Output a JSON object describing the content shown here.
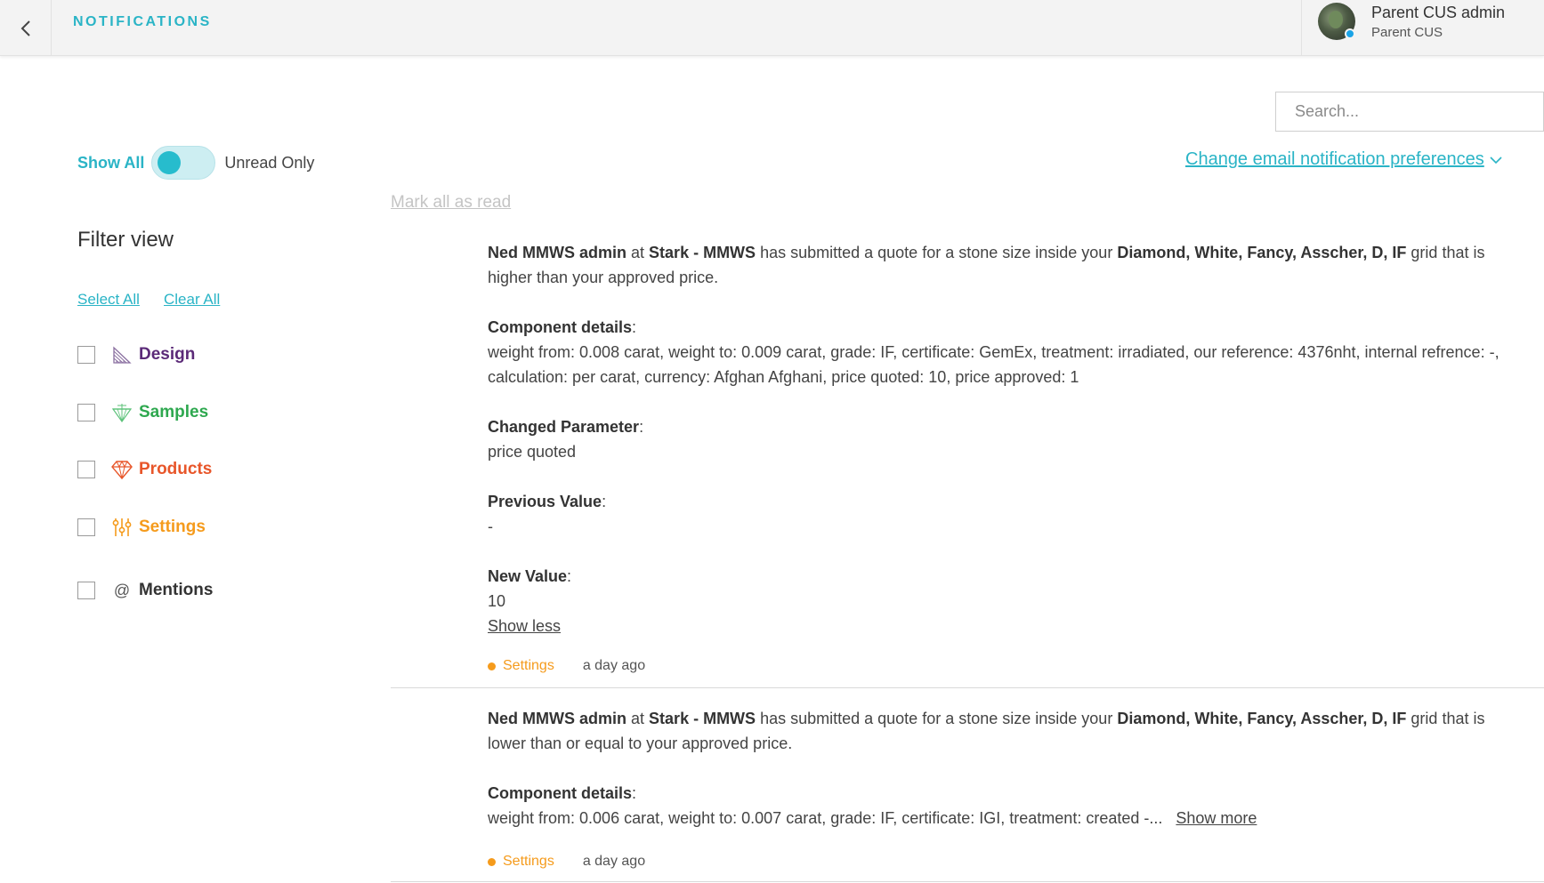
{
  "header": {
    "title": "NOTIFICATIONS",
    "user_name": "Parent CUS admin",
    "user_org": "Parent CUS"
  },
  "search": {
    "placeholder": "Search...",
    "value": ""
  },
  "toggle": {
    "left_label": "Show All",
    "right_label": "Unread Only"
  },
  "email_prefs_label": "Change email notification preferences",
  "mark_all_label": "Mark all as read",
  "filter": {
    "title": "Filter view",
    "select_all": "Select All",
    "clear_all": "Clear All",
    "items": [
      {
        "label": "Design",
        "color": "#5b2a78",
        "icon": "design-icon"
      },
      {
        "label": "Samples",
        "color": "#2ea84f",
        "icon": "samples-icon"
      },
      {
        "label": "Products",
        "color": "#e8562a",
        "icon": "products-icon"
      },
      {
        "label": "Settings",
        "color": "#f59b1c",
        "icon": "settings-icon"
      },
      {
        "label": "Mentions",
        "color": "#333333",
        "icon": "at-icon"
      }
    ]
  },
  "notifications": [
    {
      "author": "Ned MMWS admin",
      "at": "at",
      "company": "Stark - MMWS",
      "text1": "has submitted a quote for a stone size inside your",
      "grid": "Diamond, White, Fancy, Asscher, D, IF",
      "text2": "grid that is higher than your approved price.",
      "component_label": "Component details",
      "component_value": "weight from: 0.008 carat, weight to: 0.009 carat, grade: IF, certificate: GemEx, treatment: irradiated, our reference: 4376nht, internal refrence: -, calculation: per carat, currency: Afghan Afghani, price quoted: 10, price approved: 1",
      "changed_label": "Changed Parameter",
      "changed_value": "price quoted",
      "previous_label": "Previous Value",
      "previous_value": "-",
      "new_label": "New Value",
      "new_value": "10",
      "toggle_link": "Show less",
      "category": "Settings",
      "time": "a day ago"
    },
    {
      "author": "Ned MMWS admin",
      "at": "at",
      "company": "Stark - MMWS",
      "text1": "has submitted a quote for a stone size inside your",
      "grid": "Diamond, White, Fancy, Asscher, D, IF",
      "text2": "grid that is lower than or equal to your approved price.",
      "component_label": "Component details",
      "component_value": "weight from: 0.006 carat, weight to: 0.007 carat, grade: IF, certificate: IGI, treatment: created -...",
      "toggle_link": "Show more",
      "category": "Settings",
      "time": "a day ago"
    }
  ]
}
